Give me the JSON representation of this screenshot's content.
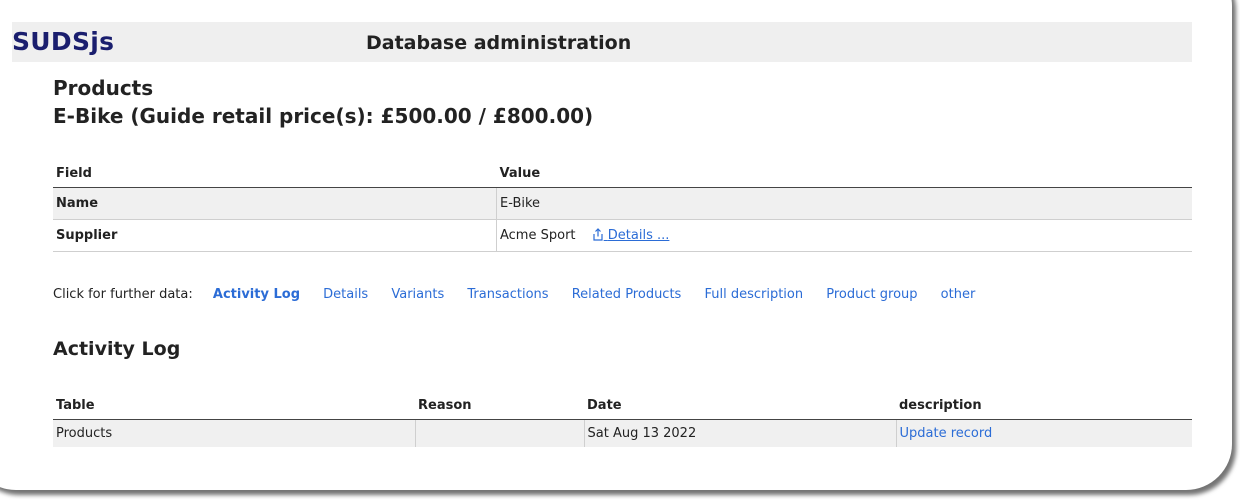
{
  "header": {
    "logo": "SUDSjs",
    "title": "Database administration"
  },
  "page": {
    "title": "Products",
    "subtitle": "E-Bike (Guide retail price(s): £500.00 / £800.00)"
  },
  "record_table": {
    "headers": [
      "Field",
      "Value"
    ],
    "rows": [
      {
        "field": "Name",
        "value": "E-Bike"
      },
      {
        "field": "Supplier",
        "value": "Acme Sport",
        "link": "Details ..."
      }
    ]
  },
  "further_data": {
    "label": "Click for further data:",
    "links": [
      "Activity Log",
      "Details",
      "Variants",
      "Transactions",
      "Related Products",
      "Full description",
      "Product group",
      "other"
    ],
    "active": "Activity Log"
  },
  "activity_log": {
    "title": "Activity Log",
    "headers": [
      "Table",
      "Reason",
      "Date",
      "description"
    ],
    "rows": [
      {
        "table": "Products",
        "reason": "",
        "date": "Sat Aug 13 2022",
        "description": "Update record"
      }
    ]
  },
  "colors": {
    "logo": "#1a1e6e",
    "link": "#2b6cd6",
    "header_bg": "#efefef",
    "row_shade": "#f0f0f0"
  },
  "icons": {
    "supplier_details": "share-icon"
  }
}
